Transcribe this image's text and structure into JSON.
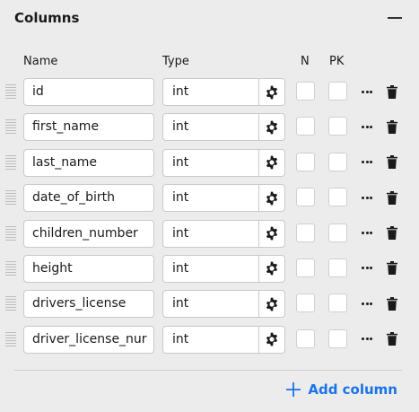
{
  "panel": {
    "title": "Columns",
    "collapse_icon": "minus-icon"
  },
  "headers": {
    "name": "Name",
    "type": "Type",
    "nullable": "N",
    "primary_key": "PK"
  },
  "columns": [
    {
      "name": "id",
      "type": "int",
      "nullable": false,
      "primary_key": false
    },
    {
      "name": "first_name",
      "type": "int",
      "nullable": false,
      "primary_key": false
    },
    {
      "name": "last_name",
      "type": "int",
      "nullable": false,
      "primary_key": false
    },
    {
      "name": "date_of_birth",
      "type": "int",
      "nullable": false,
      "primary_key": false
    },
    {
      "name": "children_number",
      "type": "int",
      "nullable": false,
      "primary_key": false
    },
    {
      "name": "height",
      "type": "int",
      "nullable": false,
      "primary_key": false
    },
    {
      "name": "drivers_license",
      "type": "int",
      "nullable": false,
      "primary_key": false
    },
    {
      "name": "driver_license_nur",
      "type": "int",
      "nullable": false,
      "primary_key": false
    }
  ],
  "footer": {
    "add_column_label": "Add column"
  },
  "colors": {
    "accent": "#1a73e8",
    "background": "#ececec",
    "border": "#c9c9c9"
  }
}
